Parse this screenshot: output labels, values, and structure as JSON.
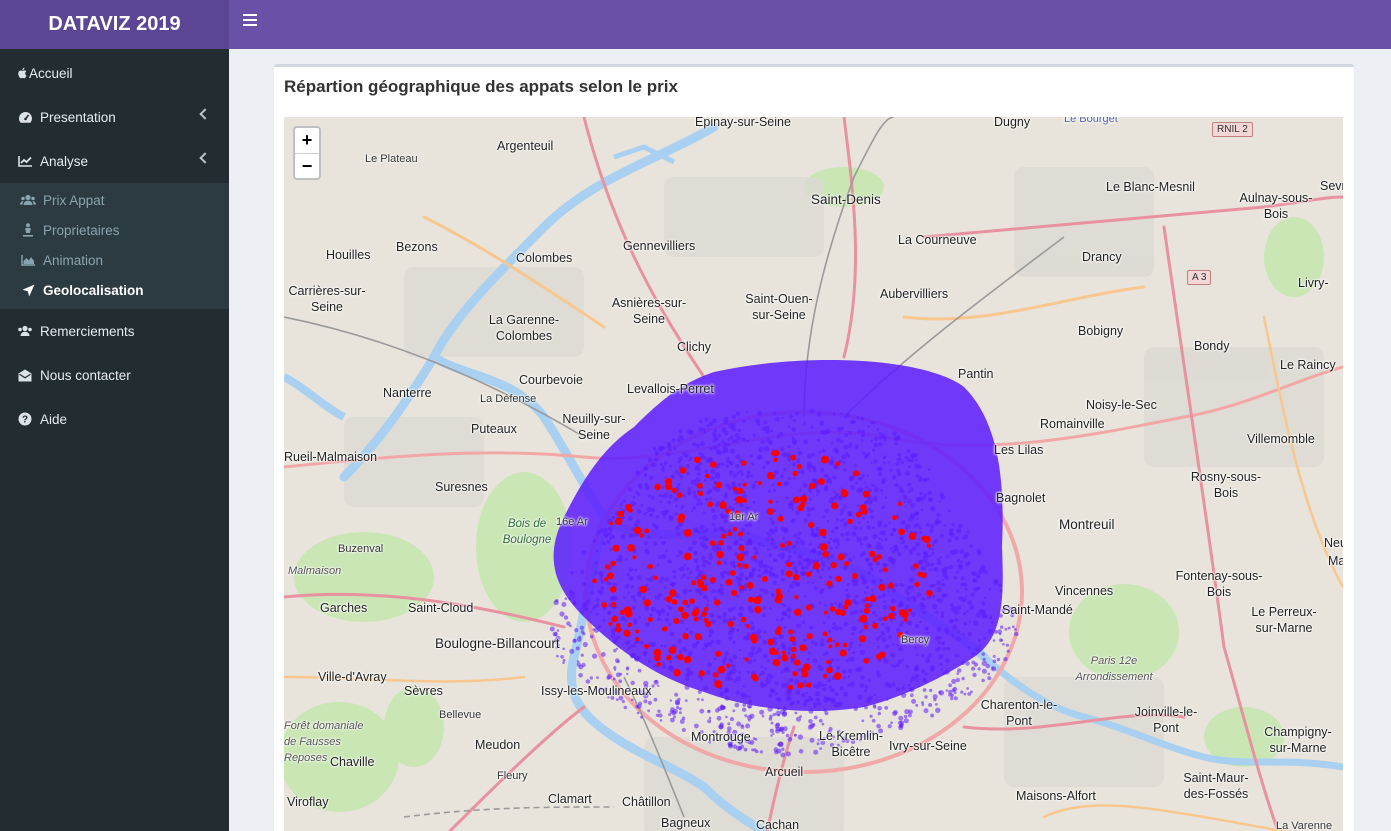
{
  "app": {
    "title": "DATAVIZ 2019"
  },
  "sidebar": {
    "items": [
      {
        "label": "Accueil",
        "icon": "apple-icon"
      },
      {
        "label": "Presentation",
        "icon": "dashboard-icon",
        "expandable": true
      },
      {
        "label": "Analyse",
        "icon": "line-chart-icon",
        "expandable": true
      },
      {
        "label": "Remerciements",
        "icon": "users-icon"
      },
      {
        "label": "Nous contacter",
        "icon": "envelope-icon"
      },
      {
        "label": "Aide",
        "icon": "question-circle-icon"
      }
    ],
    "analyse_sub": [
      {
        "label": "Prix Appat",
        "icon": "users-icon"
      },
      {
        "label": "Proprietaires",
        "icon": "person-icon"
      },
      {
        "label": "Animation",
        "icon": "area-chart-icon"
      },
      {
        "label": "Geolocalisation",
        "icon": "location-arrow-icon",
        "active": true
      }
    ]
  },
  "main": {
    "title": "Répartion géographique des appats selon le prix",
    "zoom_in": "+",
    "zoom_out": "−",
    "colors": {
      "low_price": "#5b1bff",
      "high_price": "#ff0000"
    },
    "places": [
      "Épinay-sur-Seine",
      "Dugny",
      "Le Bourget",
      "RNIL 2",
      "Argenteuil",
      "Le Plateau",
      "Saint-Denis",
      "Le Blanc-Mesnil",
      "Aulnay-sous-Bois",
      "Sevr",
      "Houilles",
      "Bezons",
      "Colombes",
      "Gennevilliers",
      "La Courneuve",
      "Drancy",
      "Carrières-sur-Seine",
      "Asnières-sur-Seine",
      "Saint-Ouen-sur-Seine",
      "Aubervilliers",
      "A 3",
      "Livry-",
      "La Garenne-Colombes",
      "Bobigny",
      "Clichy",
      "Bondy",
      "Le Raincy",
      "Nanterre",
      "Courbevoie",
      "Levallois-Perret",
      "Pantin",
      "La Défense",
      "Noisy-le-Sec",
      "Puteaux",
      "Neuilly-sur-Seine",
      "Romainville",
      "Villemomble",
      "Rueil-Malmaison",
      "Les Lilas",
      "Suresnes",
      "Bagnolet",
      "Rosny-sous-Bois",
      "Bois de Boulogne",
      "16e Ar",
      "1er Ar",
      "Montreuil",
      "Buzenval",
      "Malmaison",
      "Neuil",
      "Ma",
      "Vincennes",
      "Fontenay-sous-Bois",
      "Garches",
      "Saint-Cloud",
      "Saint-Mandé",
      "Le Perreux-sur-Marne",
      "Boulogne-Billancourt",
      "Bercy",
      "Paris 12e Arrondissement",
      "Ville-d'Avray",
      "Sèvres",
      "Issy-les-Moulineaux",
      "Charenton-le-Pont",
      "Joinville-le-Pont",
      "Bellevue",
      "Forêt domaniale de Fausses Reposes",
      "Meudon",
      "Montrouge",
      "Le Kremlin-Bicêtre",
      "Ivry-sur-Seine",
      "Champigny-sur-Marne",
      "Chaville",
      "Arcueil",
      "Fleury",
      "Saint-Maur-des-Fossés",
      "Viroflay",
      "Clamart",
      "Châtillon",
      "Maisons-Alfort",
      "Bagneux",
      "Cachan",
      "La Varenne"
    ]
  }
}
